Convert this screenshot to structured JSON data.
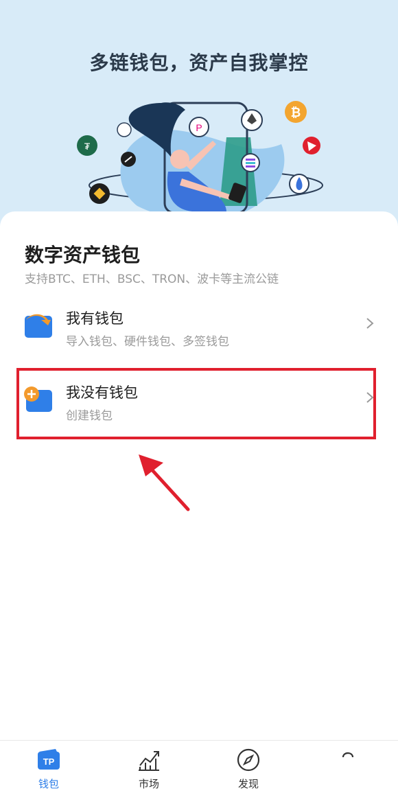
{
  "hero": {
    "title": "多链钱包，资产自我掌控"
  },
  "card": {
    "title": "数字资产钱包",
    "subtitle": "支持BTC、ETH、BSC、TRON、波卡等主流公链",
    "options": [
      {
        "title": "我有钱包",
        "desc": "导入钱包、硬件钱包、多签钱包",
        "icon": "import-wallet-icon"
      },
      {
        "title": "我没有钱包",
        "desc": "创建钱包",
        "icon": "create-wallet-icon"
      }
    ]
  },
  "bottom_nav": {
    "items": [
      {
        "label": "钱包",
        "icon": "tp-wallet-icon",
        "active": true
      },
      {
        "label": "市场",
        "icon": "chart-trend-icon",
        "active": false
      },
      {
        "label": "发现",
        "icon": "compass-icon",
        "active": false
      },
      {
        "label": "",
        "icon": "profile-icon",
        "active": false
      }
    ]
  },
  "colors": {
    "accent": "#2f7fe8",
    "highlight": "#e0202e",
    "hero_bg": "#d8ebf8"
  }
}
